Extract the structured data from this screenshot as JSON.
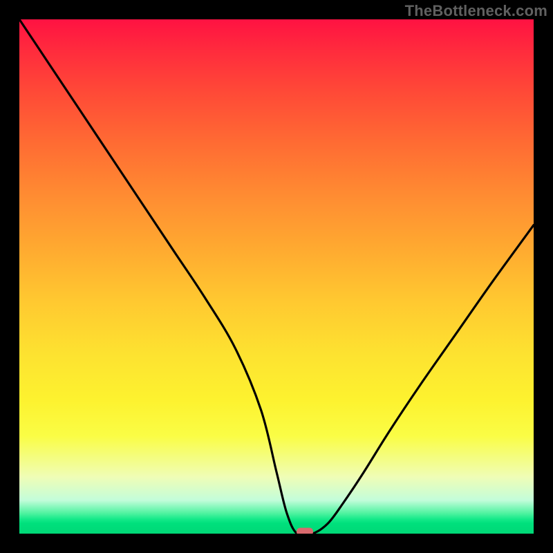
{
  "watermark": "TheBottleneck.com",
  "chart_data": {
    "type": "line",
    "title": "",
    "xlabel": "",
    "ylabel": "",
    "xlim": [
      0,
      100
    ],
    "ylim": [
      0,
      100
    ],
    "grid": false,
    "legend": false,
    "series": [
      {
        "name": "bottleneck-curve",
        "x": [
          0,
          6,
          12,
          18,
          24,
          30,
          36,
          42,
          47,
          50,
          52,
          54,
          57,
          60,
          63,
          67,
          72,
          78,
          85,
          92,
          100
        ],
        "values": [
          100,
          91,
          82,
          73,
          64,
          55,
          46,
          36,
          24,
          12,
          4,
          0,
          0,
          2,
          6,
          12,
          20,
          29,
          39,
          49,
          60
        ]
      }
    ],
    "minimum_marker": {
      "x": 55.5,
      "y": 0
    },
    "gradient_colors": {
      "worst": "#ff1242",
      "mid": "#fde230",
      "best": "#00d877"
    }
  }
}
